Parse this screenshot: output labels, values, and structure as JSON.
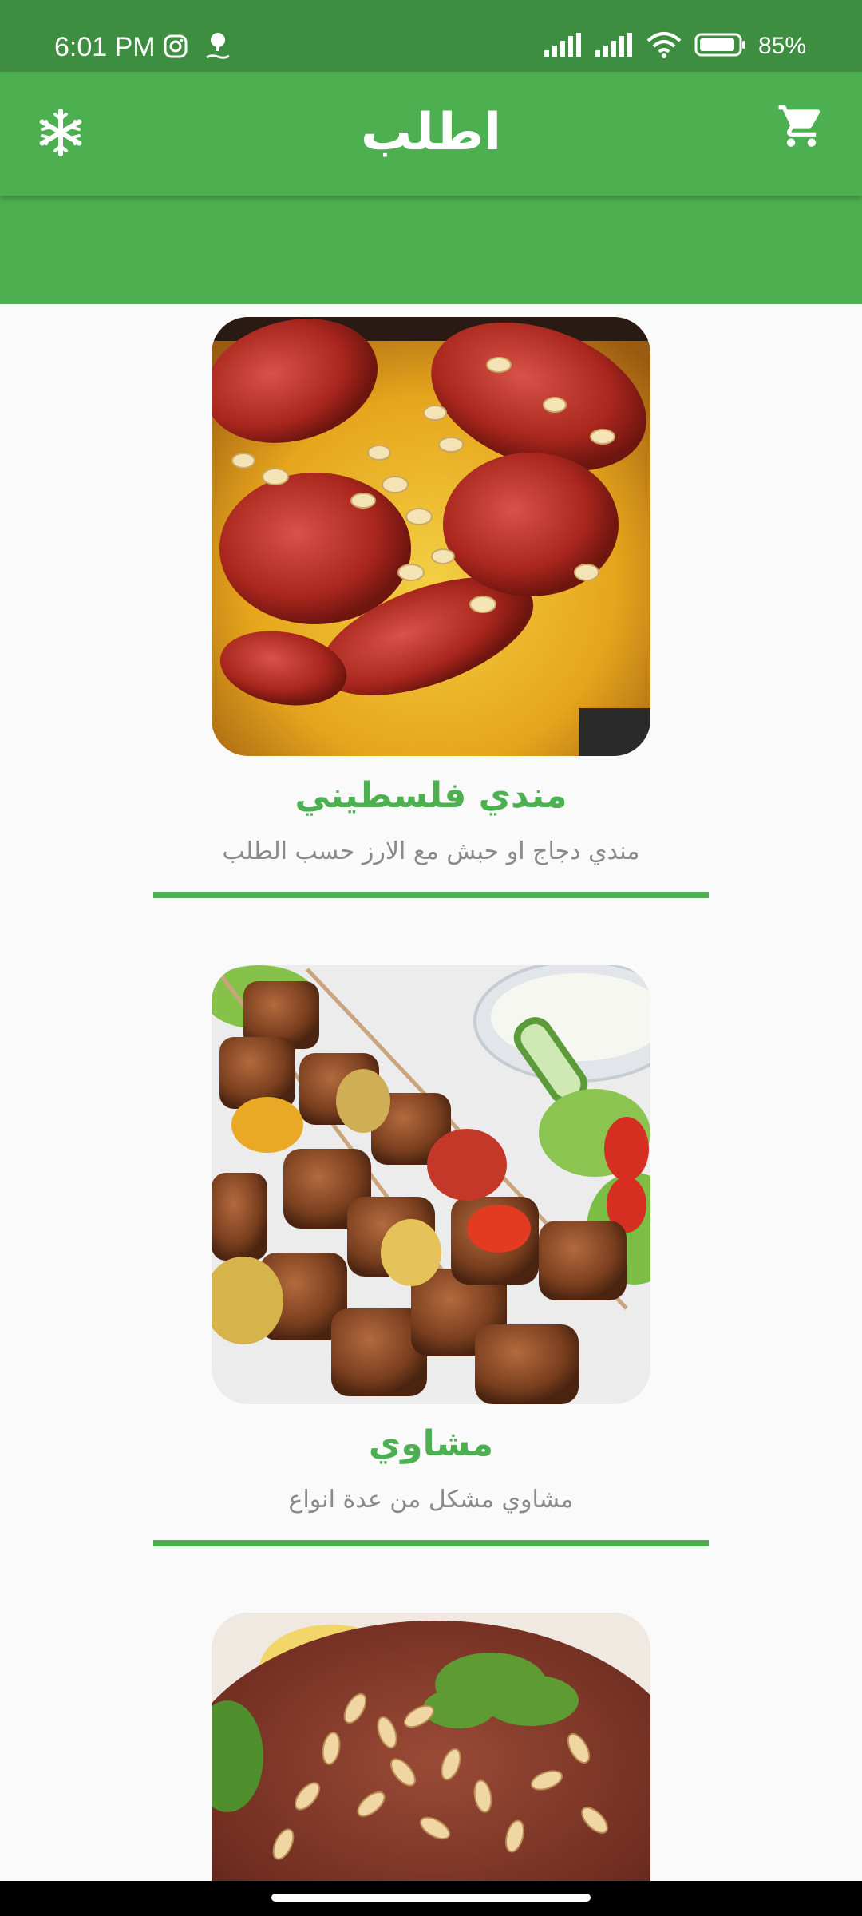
{
  "status_bar": {
    "time": "6:01 PM",
    "battery_text": "85%",
    "icons": [
      "instagram-icon",
      "app-notification-icon",
      "signal-icon",
      "signal-icon-2",
      "wifi-icon",
      "battery-icon"
    ]
  },
  "app_bar": {
    "title": "اطلب",
    "left_icon": "snowflake-icon",
    "right_icon": "cart-icon",
    "color": "#4caf50"
  },
  "menu": {
    "items": [
      {
        "title": "مندي فلسطيني",
        "description": "مندي دجاج او حبش مع الارز  حسب الطلب",
        "image": "chicken-mandi-photo"
      },
      {
        "title": "مشاوي",
        "description": "مشاوي مشكل من عدة انواع",
        "image": "grilled-skewers-photo"
      },
      {
        "title": "",
        "description": "",
        "image": "musakhan-chicken-photo"
      }
    ]
  }
}
